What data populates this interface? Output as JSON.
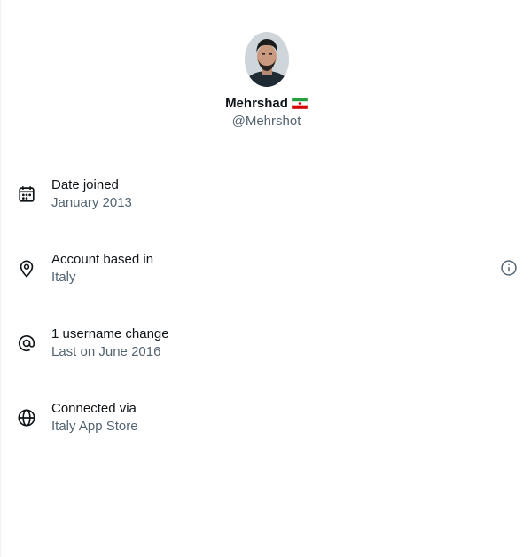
{
  "profile": {
    "display_name": "Mehrshad",
    "handle": "@Mehrshot",
    "flag_icon": "iran-flag-emoji"
  },
  "rows": [
    {
      "icon": "calendar-icon",
      "label": "Date joined",
      "value": "January 2013"
    },
    {
      "icon": "location-pin-icon",
      "label": "Account based in",
      "value": "Italy",
      "trailing_icon": "info-icon"
    },
    {
      "icon": "at-sign-icon",
      "label": "1 username change",
      "value": "Last on June 2016"
    },
    {
      "icon": "globe-icon",
      "label": "Connected via",
      "value": "Italy App Store"
    }
  ],
  "colors": {
    "primary_text": "#0f1419",
    "secondary_text": "#536471",
    "border": "#eff3f4"
  }
}
